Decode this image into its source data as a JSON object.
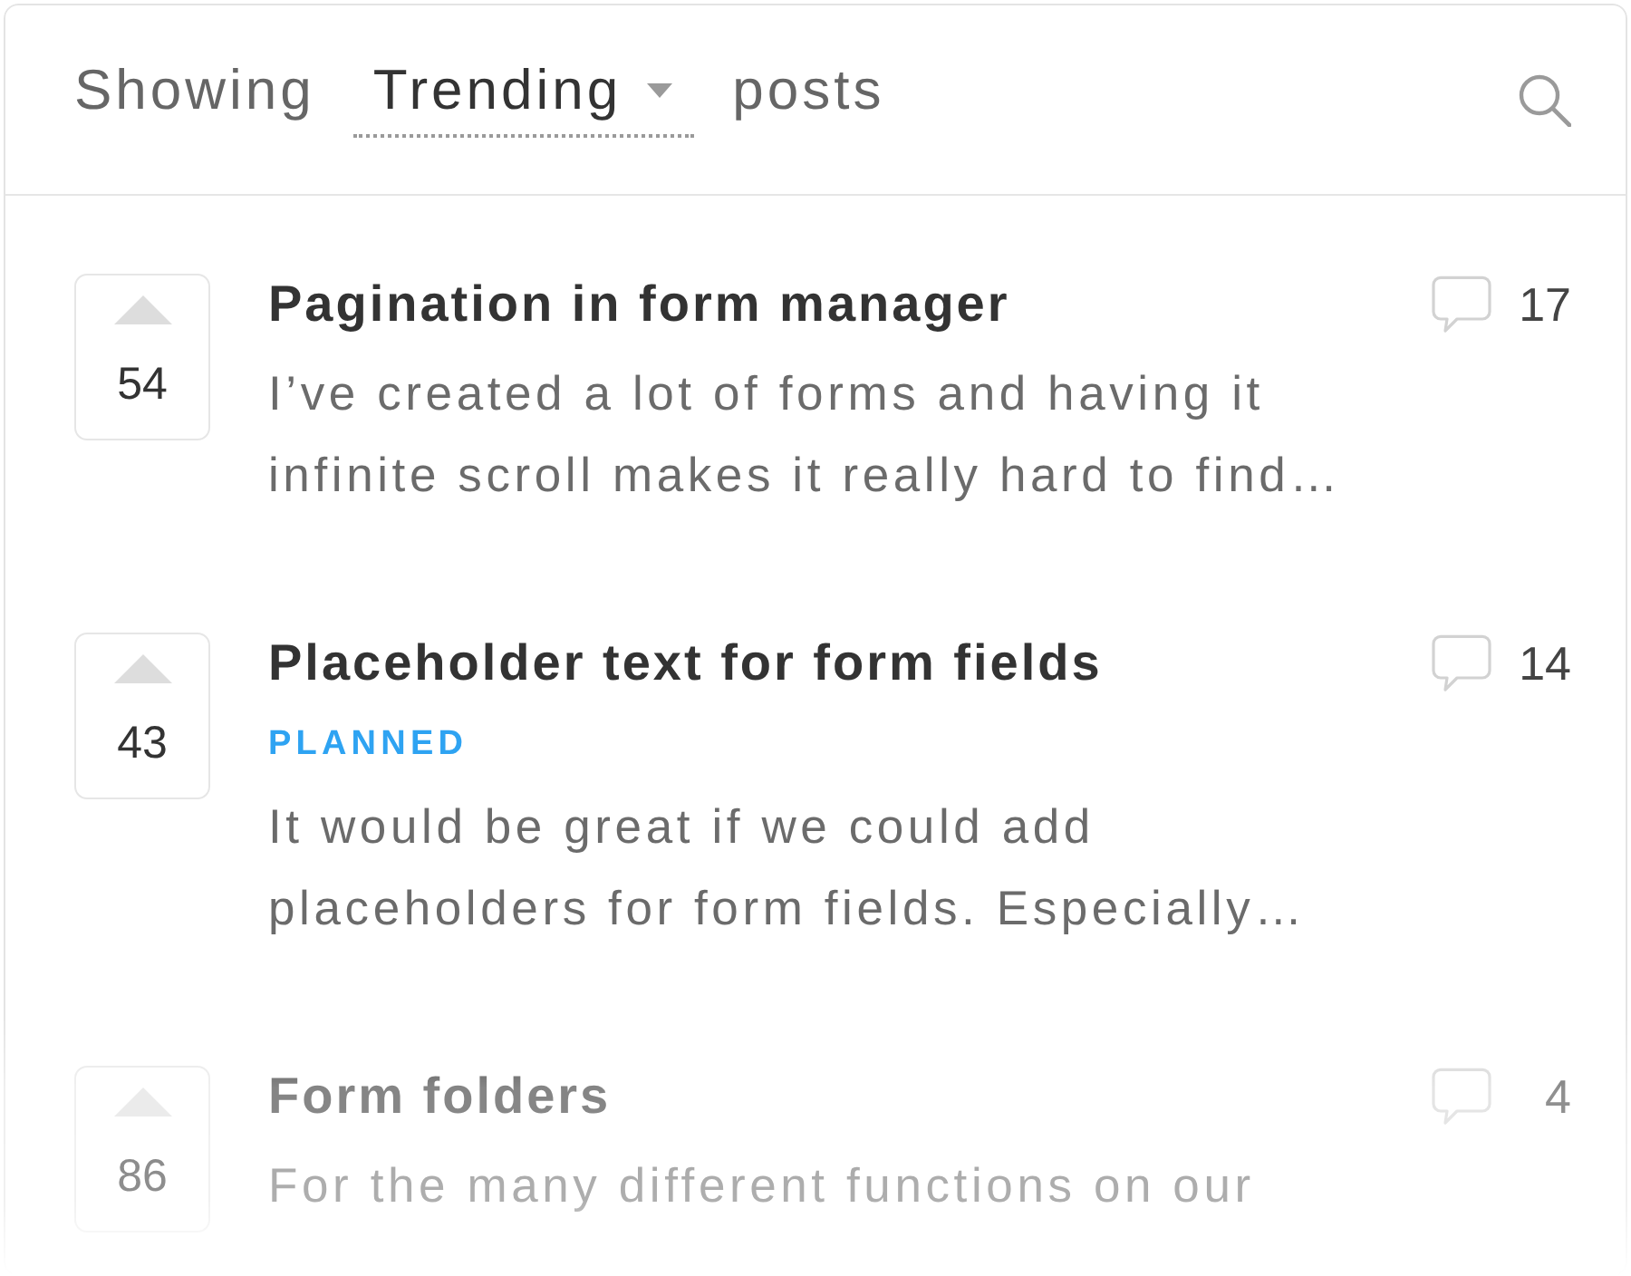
{
  "header": {
    "prefix": "Showing",
    "sort": {
      "label": "Trending"
    },
    "suffix": "posts"
  },
  "posts": [
    {
      "votes": "54",
      "title": "Pagination in form manager",
      "body": "I’ve created a lot of forms and having it\ninfinite scroll makes it really hard to find…",
      "comments": "17"
    },
    {
      "votes": "43",
      "title": "Placeholder text for form fields",
      "status": "PLANNED",
      "body": "It would be great if we could add\nplaceholders for form fields. Especially…",
      "comments": "14"
    },
    {
      "votes": "86",
      "title": "Form folders",
      "body": "For the many different functions on our",
      "comments": "4"
    }
  ]
}
